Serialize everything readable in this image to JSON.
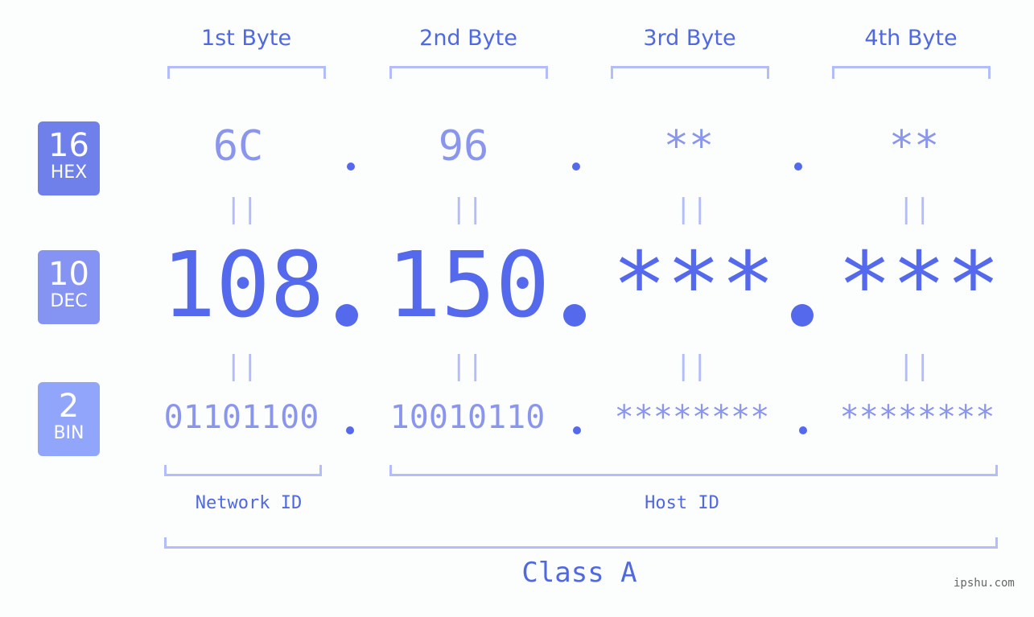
{
  "bytes": [
    {
      "label": "1st Byte",
      "hex": "6C",
      "dec": "108",
      "bin": "01101100"
    },
    {
      "label": "2nd Byte",
      "hex": "96",
      "dec": "150",
      "bin": "10010110"
    },
    {
      "label": "3rd Byte",
      "hex": "**",
      "dec": "***",
      "bin": "********"
    },
    {
      "label": "4th Byte",
      "hex": "**",
      "dec": "***",
      "bin": "********"
    }
  ],
  "badges": {
    "hex": {
      "num": "16",
      "label": "HEX",
      "color": "#7080ea"
    },
    "dec": {
      "num": "10",
      "label": "DEC",
      "color": "#8594f2"
    },
    "bin": {
      "num": "2",
      "label": "BIN",
      "color": "#91a6fa"
    }
  },
  "equals_sign": "||",
  "network_id_label": "Network ID",
  "host_id_label": "Host ID",
  "class_label": "Class A",
  "watermark": "ipshu.com"
}
